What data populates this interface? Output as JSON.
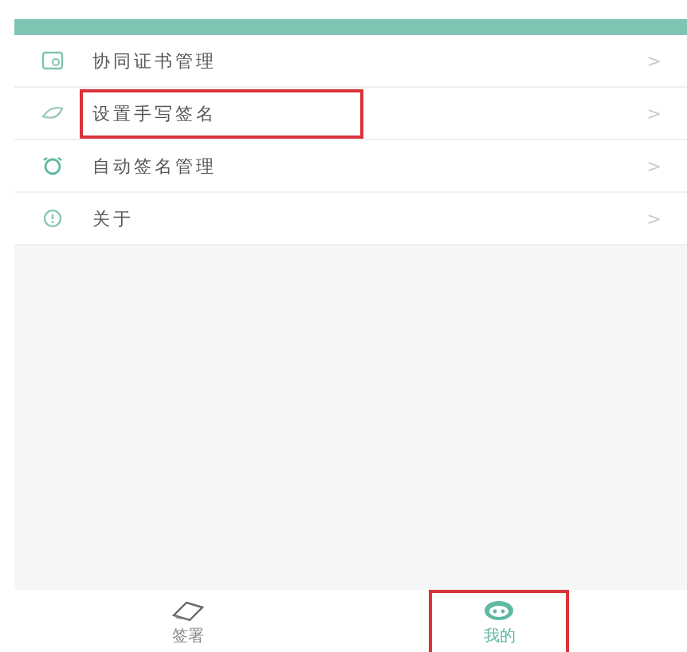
{
  "menu": [
    {
      "kind": "certificate",
      "label": "协同证书管理",
      "chevron": ">",
      "highlighted": false
    },
    {
      "kind": "signature",
      "label": "设置手写签名",
      "chevron": ">",
      "highlighted": true
    },
    {
      "kind": "clock",
      "label": "自动签名管理",
      "chevron": ">",
      "highlighted": false
    },
    {
      "kind": "info",
      "label": "关于",
      "chevron": ">",
      "highlighted": false
    }
  ],
  "tabs": [
    {
      "kind": "sign",
      "label": "签署",
      "selected": false,
      "highlighted": false
    },
    {
      "kind": "mine",
      "label": "我的",
      "selected": true,
      "highlighted": true
    }
  ]
}
